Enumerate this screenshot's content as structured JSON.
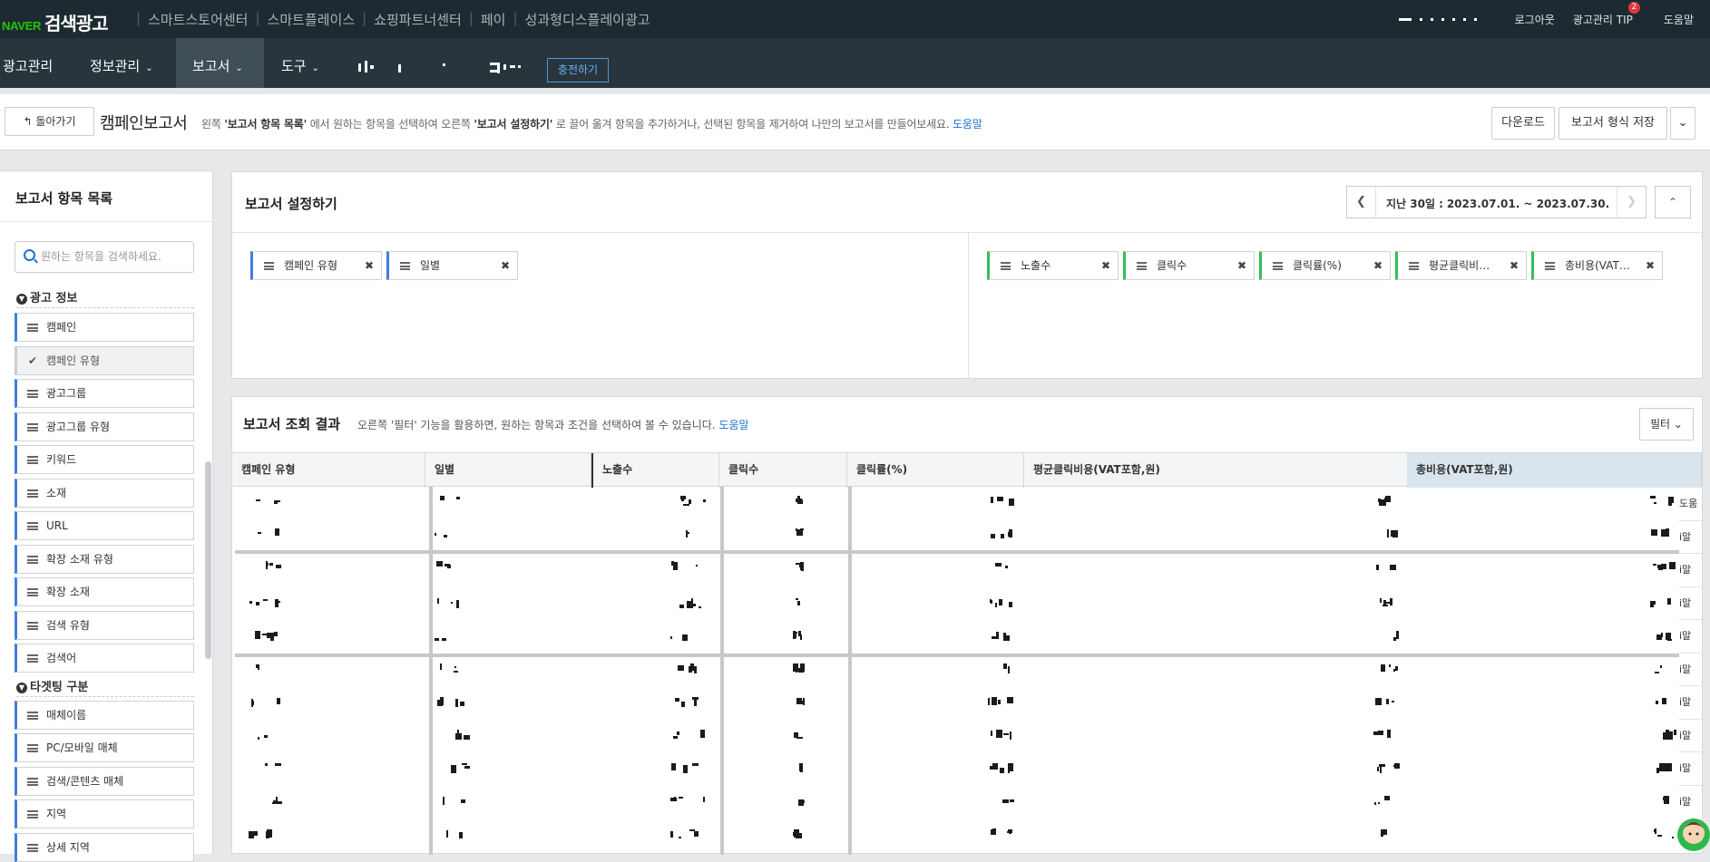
{
  "topbar": {
    "logo_naver": "NAVER",
    "logo_sa": "검색광고",
    "nav": [
      "스마트스토어센터",
      "스마트플레이스",
      "쇼핑파트너센터",
      "페이",
      "성과형디스플레이광고"
    ],
    "logout": "로그아웃",
    "tip": "광고관리 TIP",
    "tip_badge": "2",
    "help": "도움말"
  },
  "subnav": {
    "items": [
      {
        "label": "광고관리"
      },
      {
        "label": "정보관리"
      },
      {
        "label": "보고서"
      },
      {
        "label": "도구"
      }
    ],
    "charge": "충전하기"
  },
  "header": {
    "back": "돌아가기",
    "title": "캠페인보고서",
    "desc_1": "왼쪽 ",
    "desc_b1": "'보고서 항목 목록'",
    "desc_2": " 에서 원하는 항목을 선택하여 오른쪽 ",
    "desc_b2": "'보고서 설정하기'",
    "desc_3": " 로 끌어 옮겨 항목을 추가하거나, 선택된 항목을 제거하여 나만의 보고서를 만들어보세요.",
    "desc_link": "도움말",
    "download": "다운로드",
    "save_format": "보고서 형식 저장"
  },
  "left": {
    "title": "보고서 항목 목록",
    "search_placeholder": "원하는 항목을 검색하세요.",
    "sec1": "광고 정보",
    "items1": [
      "캠페인",
      "캠페인 유형",
      "광고그룹",
      "광고그룹 유형",
      "키워드",
      "소재",
      "URL",
      "확장 소재 유형",
      "확장 소재",
      "검색 유형",
      "검색어"
    ],
    "sec2": "타겟팅 구분",
    "items2": [
      "매체이름",
      "PC/모바일 매체",
      "검색/콘텐츠 매체",
      "지역",
      "상세 지역"
    ]
  },
  "settings": {
    "title": "보고서 설정하기",
    "date_label": "지난 30일 :",
    "date_range": "2023.07.01. ~ 2023.07.30.",
    "dims": [
      "캠페인 유형",
      "일별"
    ],
    "metrics": [
      "노출수",
      "클릭수",
      "클릭률(%)",
      "평균클릭비…",
      "총비용(VAT…"
    ]
  },
  "results": {
    "title": "보고서 조회 결과",
    "desc_1": "오른쪽 '필터' 기능을 활용하면, 원하는 항목과 조건을 선택하여 볼 수 있습니다.",
    "desc_link": "도움말",
    "filter": "필터",
    "columns": [
      "캠페인 유형",
      "일별",
      "노출수",
      "클릭수",
      "클릭률(%)",
      "평균클릭비용(VAT포함,원)",
      "총비용(VAT포함,원)"
    ],
    "right_col": [
      "도움",
      "i말",
      "i말",
      "i말",
      "i말",
      "i말",
      "i말",
      "i말",
      "i말",
      "i말"
    ]
  }
}
